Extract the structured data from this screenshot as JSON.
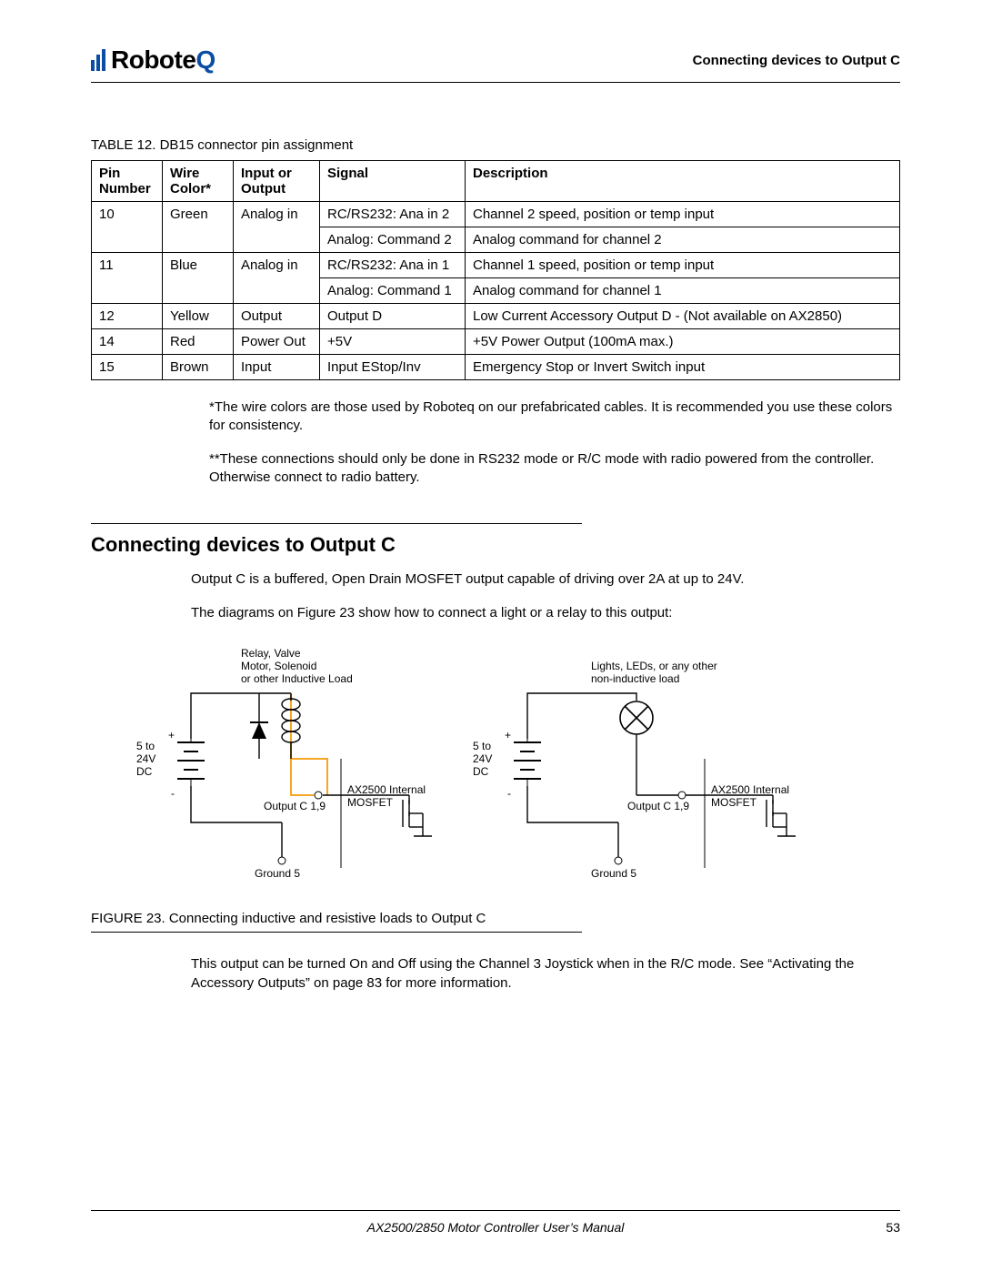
{
  "header": {
    "brand_prefix": "Robote",
    "brand_suffix": "Q",
    "running_title": "Connecting devices to Output C"
  },
  "table": {
    "caption": "TABLE 12. DB15 connector pin assignment",
    "headers": {
      "pin": "Pin Number",
      "wire": "Wire Color*",
      "io": "Input or Output",
      "signal": "Signal",
      "desc": "Description"
    },
    "rows": [
      {
        "pin": "10",
        "wire": "Green",
        "io": "Analog in",
        "signal": "RC/RS232: Ana in 2",
        "desc": "Channel 2 speed, position or temp input"
      },
      {
        "pin": "",
        "wire": "",
        "io": "",
        "signal": "Analog: Command 2",
        "desc": "Analog command for channel 2"
      },
      {
        "pin": "11",
        "wire": "Blue",
        "io": "Analog in",
        "signal": "RC/RS232: Ana in 1",
        "desc": "Channel 1 speed, position or temp input"
      },
      {
        "pin": "",
        "wire": "",
        "io": "",
        "signal": "Analog: Command 1",
        "desc": "Analog command for channel 1"
      },
      {
        "pin": "12",
        "wire": "Yellow",
        "io": "Output",
        "signal": "Output D",
        "desc": "Low Current Accessory Output D - (Not available on AX2850)"
      },
      {
        "pin": "14",
        "wire": "Red",
        "io": "Power Out",
        "signal": "+5V",
        "desc": "+5V Power Output (100mA max.)"
      },
      {
        "pin": "15",
        "wire": "Brown",
        "io": "Input",
        "signal": "Input EStop/Inv",
        "desc": "Emergency Stop or Invert Switch input"
      }
    ]
  },
  "notes": {
    "n1": "*The wire colors are those used by Roboteq on our prefabricated cables. It is recommended you use these colors for consistency.",
    "n2": "**These connections should only be done in RS232 mode or R/C mode with radio powered from the controller. Otherwise connect to radio battery."
  },
  "section": {
    "title": "Connecting devices to Output C",
    "p1": "Output C is a buffered, Open Drain MOSFET output capable of driving over 2A at up to 24V.",
    "p2": "The diagrams on Figure 23 show how to connect a light or a relay to this output:",
    "p3": "This output can be turned On and Off using the Channel 3 Joystick when in the R/C mode. See “Activating the Accessory Outputs” on page 83 for more information."
  },
  "figure": {
    "caption": "FIGURE 23.  Connecting inductive and resistive loads to Output C",
    "left": {
      "load_label_l1": "Relay, Valve",
      "load_label_l2": "Motor, Solenoid",
      "load_label_l3": "or other Inductive Load",
      "v_label_l1": "5 to",
      "v_label_l2": "24V",
      "v_label_l3": "DC",
      "plus": "+",
      "minus": "-",
      "outc": "Output C  1,9",
      "mosfet_l1": "AX2500 Internal",
      "mosfet_l2": "MOSFET",
      "gnd": "Ground   5"
    },
    "right": {
      "load_label_l1": "Lights, LEDs, or any other",
      "load_label_l2": "non-inductive load",
      "v_label_l1": "5 to",
      "v_label_l2": "24V",
      "v_label_l3": "DC",
      "plus": "+",
      "minus": "-",
      "outc": "Output C  1,9",
      "mosfet_l1": "AX2500 Internal",
      "mosfet_l2": "MOSFET",
      "gnd": "Ground   5"
    }
  },
  "footer": {
    "title": "AX2500/2850 Motor Controller User’s Manual",
    "page": "53"
  }
}
